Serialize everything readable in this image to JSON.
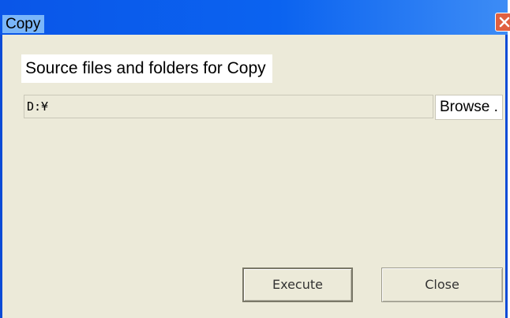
{
  "window": {
    "title": "Copy"
  },
  "dialog": {
    "heading": "Source files and folders for Copy",
    "path_value": "D:¥",
    "browse_label": "Browse .",
    "execute_label": "Execute",
    "close_label": "Close"
  },
  "icons": {
    "close": "close-icon"
  },
  "colors": {
    "titlebar": "#0b63f0",
    "title_highlight": "#7ab6f9",
    "window_bg": "#ecead9",
    "close_button": "#e06040"
  }
}
